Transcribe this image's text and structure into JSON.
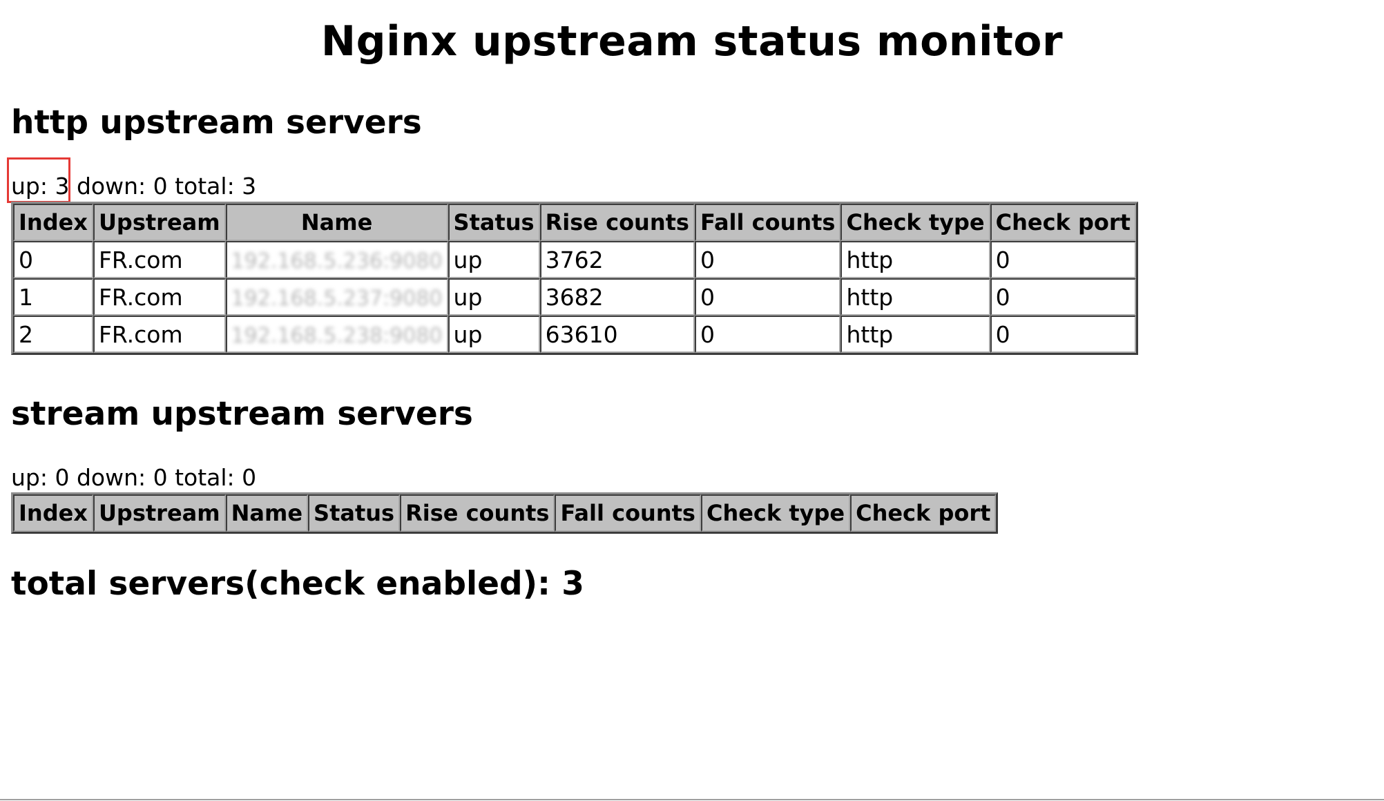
{
  "page_title": "Nginx upstream status monitor",
  "http_section": {
    "heading": "http upstream servers",
    "up_text": "up: 3",
    "rest_text": "down: 0 total: 3",
    "columns": [
      "Index",
      "Upstream",
      "Name",
      "Status",
      "Rise counts",
      "Fall counts",
      "Check type",
      "Check port"
    ],
    "rows": [
      {
        "index": "0",
        "upstream": "FR.com",
        "name": "192.168.5.236:9080",
        "status": "up",
        "rise": "3762",
        "fall": "0",
        "type": "http",
        "port": "0"
      },
      {
        "index": "1",
        "upstream": "FR.com",
        "name": "192.168.5.237:9080",
        "status": "up",
        "rise": "3682",
        "fall": "0",
        "type": "http",
        "port": "0"
      },
      {
        "index": "2",
        "upstream": "FR.com",
        "name": "192.168.5.238:9080",
        "status": "up",
        "rise": "63610",
        "fall": "0",
        "type": "http",
        "port": "0"
      }
    ]
  },
  "stream_section": {
    "heading": "stream upstream servers",
    "summary": "up: 0 down: 0 total: 0",
    "columns": [
      "Index",
      "Upstream",
      "Name",
      "Status",
      "Rise counts",
      "Fall counts",
      "Check type",
      "Check port"
    ]
  },
  "total_text": "total servers(check enabled): 3",
  "colors": {
    "highlight": "#e53935",
    "header_bg": "#c0c0c0"
  }
}
